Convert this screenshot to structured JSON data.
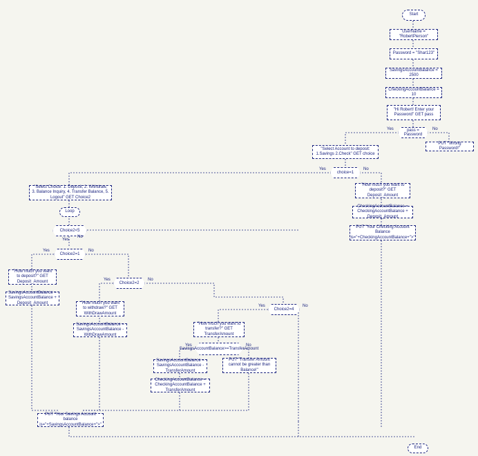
{
  "start": "Start",
  "end": "End",
  "username": "UserName = \"RobertPierson\"",
  "password": "Password = \"Shar123\"",
  "savings_init": "SavingsAccountBalance = 2500",
  "checking_init": "CheckingAccountBalance = 10",
  "greet": "\"Hi Robert! Enter your Password\" GET pass",
  "pass_check": "pass = Password",
  "wrong_pw": "PUT \"Wrong Password!\"",
  "select_deposit_acct": "\"Select Account to deposit: 1.Savings  2.Check\" GET choice",
  "choice1_check": "choice=1",
  "deposit_checking_prompt": "\"How much you want to deposit?\" GET Deposit_Amount",
  "checking_add": "CheckingAccountBalance = CheckingAccountBalance + Deposit_Amount",
  "put_checking": "PUT \"Your Checking Account Balance is=\"+CheckingAccountBalance+\">\"",
  "main_menu": "\"Select Choice: 1. Deposit, 2. Withdraw, 3. Balance Inquiry, 4. Transfer Balance, 5. Logout\" GET Choice2",
  "loop": "Loop",
  "loop_cond": "Choice2<5",
  "c2_1": "Choice2=1",
  "c2_2": "Choice2=2",
  "c2_4": "Choice2=4",
  "deposit_savings_prompt": "\"How much you want to deposit?\" GET Deposit_Amount",
  "savings_add": "SavingsAccountBalance = SavingsAccountBalance + Deposit_Amount",
  "withdraw_prompt": "\"How much you want to withdraw?\" GET WithDrawAmount",
  "savings_sub_withdraw": "SavingsAccountBalance = SavingsAccountBalance - WithDrawAmount",
  "transfer_prompt": "\"How much you want to transfer?\" GET TransferAmount",
  "transfer_check": "SavingsAccountBalance>=TransferAmount",
  "savings_sub_transfer": "SavingsAccountBalance = SavingsAccountBalance - TransferAmount",
  "checking_add_transfer": "CheckingAccountBalance = CheckingAccountBalance + TransferAmount",
  "transfer_fail": "PUT \"Transfer Amount cannot be greater than Balance!\"",
  "put_savings": "PUT \"Your Savings Account balance is=\"+SavingsAccountBalance+\">\"",
  "yes": "Yes",
  "no": "No"
}
